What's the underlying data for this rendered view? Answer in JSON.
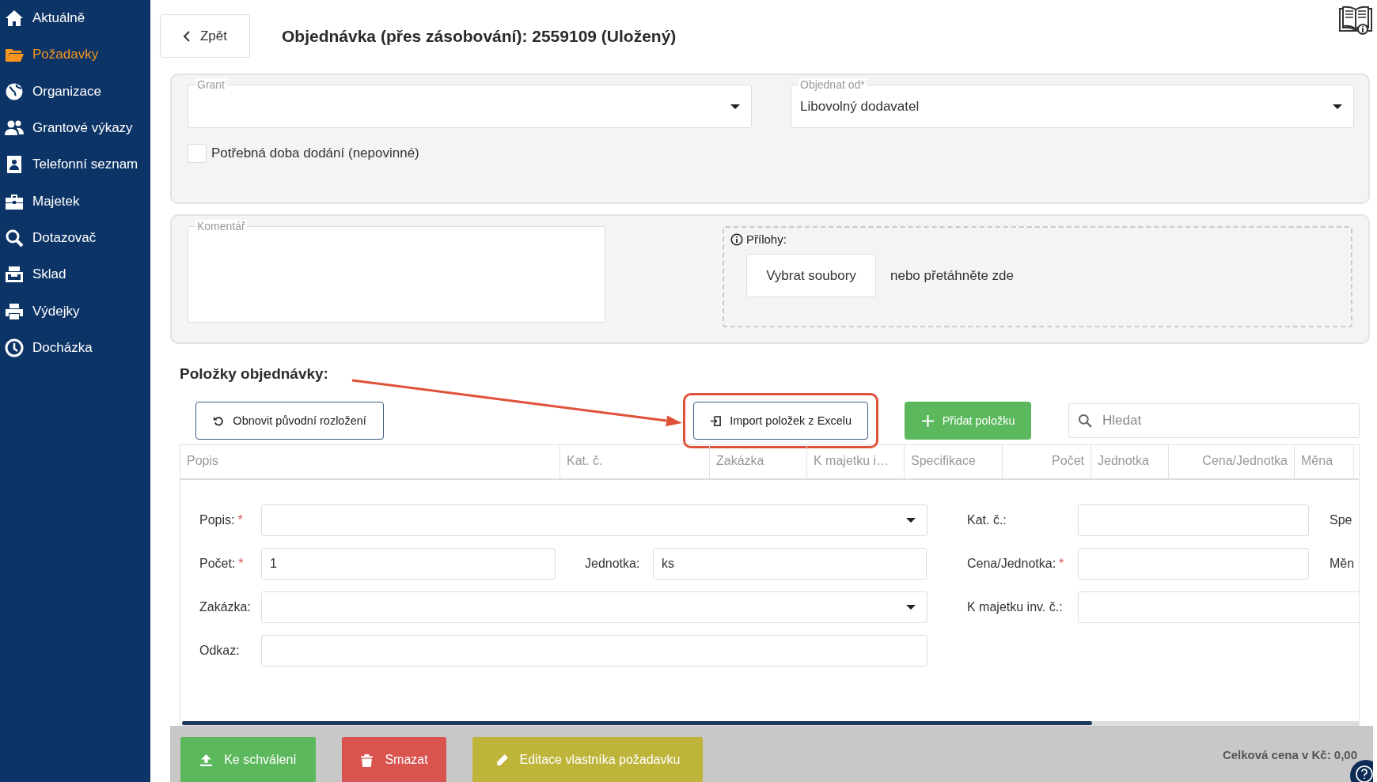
{
  "sidebar": {
    "items": [
      {
        "label": "Aktuálně",
        "selected": false
      },
      {
        "label": "Požadavky",
        "selected": true
      },
      {
        "label": "Organizace",
        "selected": false
      },
      {
        "label": "Grantové výkazy",
        "selected": false
      },
      {
        "label": "Telefonní seznam",
        "selected": false
      },
      {
        "label": "Majetek",
        "selected": false
      },
      {
        "label": "Dotazovač",
        "selected": false
      },
      {
        "label": "Sklad",
        "selected": false
      },
      {
        "label": "Výdejky",
        "selected": false
      },
      {
        "label": "Docházka",
        "selected": false
      }
    ]
  },
  "header": {
    "back_button": "Zpět",
    "title": "Objednávka (přes zásobování): 2559109 (Uložený)"
  },
  "order": {
    "grant": {
      "label": "Grant"
    },
    "supplier": {
      "label": "Objednat od*",
      "value": "Libovolný dodavatel"
    },
    "delivery_time": {
      "label": "Potřebná doba dodání (nepovinné)",
      "checked": false
    }
  },
  "comment": {
    "label": "Komentář"
  },
  "attachments": {
    "label": "Přílohy:",
    "button": "Vybrat soubory",
    "hint": "nebo přetáhněte zde"
  },
  "items_section": {
    "title": "Položky objednávky:",
    "reset_button": "Obnovit původní rozložení",
    "import_button": "Import položek z Excelu",
    "add_button": "Přidat položku",
    "search": {
      "placeholder": "Hledat"
    }
  },
  "table": {
    "columns": [
      {
        "label": "Popis",
        "kind": "text"
      },
      {
        "label": "Kat. č.",
        "kind": "text"
      },
      {
        "label": "Zakázka",
        "kind": "text"
      },
      {
        "label": "K majetku i…",
        "kind": "text"
      },
      {
        "label": "Specifikace",
        "kind": "text"
      },
      {
        "label": "Počet",
        "kind": "number"
      },
      {
        "label": "Jednotka",
        "kind": "text"
      },
      {
        "label": "Cena/Jednotka",
        "kind": "number"
      },
      {
        "label": "Měna",
        "kind": "text"
      }
    ]
  },
  "item_form": {
    "rows": [
      {
        "main": [
          {
            "label": "Popis:",
            "required_mark": "*",
            "kind": "select"
          }
        ],
        "side": [
          {
            "label": "Kat. č.:",
            "kind": "text"
          },
          {
            "label": "Spe",
            "kind": "cut"
          }
        ]
      },
      {
        "main": [
          {
            "label": "Počet:",
            "required_mark": "*",
            "kind": "text",
            "value": "1"
          },
          {
            "label": "Jednotka:",
            "kind": "text",
            "value": "ks"
          }
        ],
        "side": [
          {
            "label": "Cena/Jednotka:",
            "required_mark": "*",
            "kind": "text"
          },
          {
            "label": "Měn",
            "kind": "cut"
          }
        ]
      },
      {
        "main": [
          {
            "label": "Zakázka:",
            "kind": "select"
          }
        ],
        "side": [
          {
            "label": "K majetku inv. č.:",
            "kind": "wide"
          }
        ]
      },
      {
        "main": [
          {
            "label": "Odkaz:",
            "kind": "text"
          }
        ]
      }
    ]
  },
  "footer": {
    "buttons": [
      {
        "label": "Ke schválení",
        "kind": "approve"
      },
      {
        "label": "Smazat",
        "kind": "delete"
      },
      {
        "label": "Editace vlastníka požadavku",
        "kind": "edit"
      }
    ],
    "total": "Celková cena v Kč: 0,00"
  }
}
